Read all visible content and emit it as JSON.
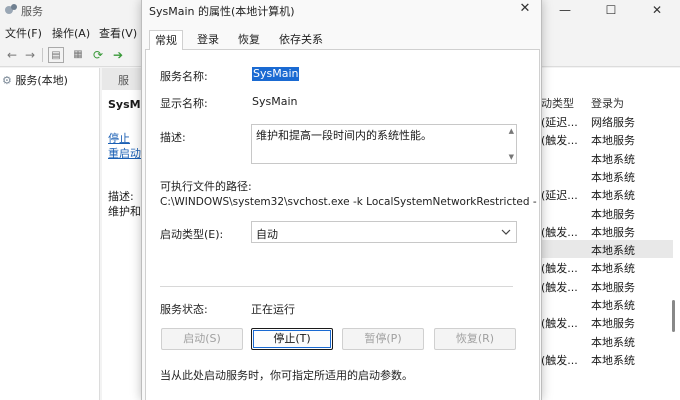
{
  "bg_window": {
    "title": "服务",
    "controls": [
      "—",
      "☐",
      "✕"
    ],
    "menu": [
      "文件(F)",
      "操作(A)",
      "查看(V)"
    ],
    "tree_item": "服务(本地)",
    "detail_header": "服",
    "detail": {
      "name": "SysM",
      "link_stop": "停止",
      "link_restart": "重启动",
      "desc_label": "描述:",
      "desc_text": "维护和"
    },
    "list": {
      "headers": [
        "动类型",
        "登录为"
      ],
      "rows": [
        {
          "startup": "(延迟...",
          "logon": "网络服务",
          "selected": false
        },
        {
          "startup": "(触发...",
          "logon": "本地服务",
          "selected": false
        },
        {
          "startup": "",
          "logon": "本地系统",
          "selected": false
        },
        {
          "startup": "",
          "logon": "本地系统",
          "selected": false
        },
        {
          "startup": "(延迟...",
          "logon": "本地系统",
          "selected": false
        },
        {
          "startup": "",
          "logon": "本地服务",
          "selected": false
        },
        {
          "startup": "(触发...",
          "logon": "本地服务",
          "selected": false
        },
        {
          "startup": "",
          "logon": "本地系统",
          "selected": true
        },
        {
          "startup": "(触发...",
          "logon": "本地系统",
          "selected": false
        },
        {
          "startup": "(触发...",
          "logon": "本地服务",
          "selected": false
        },
        {
          "startup": "",
          "logon": "本地系统",
          "selected": false
        },
        {
          "startup": "(触发...",
          "logon": "本地服务",
          "selected": false
        },
        {
          "startup": "",
          "logon": "本地系统",
          "selected": false
        },
        {
          "startup": "(触发...",
          "logon": "本地系统",
          "selected": false
        }
      ]
    }
  },
  "dialog": {
    "title": "SysMain 的属性(本地计算机)",
    "close": "✕",
    "tabs": [
      "常规",
      "登录",
      "恢复",
      "依存关系"
    ],
    "active_tab": "常规",
    "service_name_label": "服务名称:",
    "service_name": "SysMain",
    "display_name_label": "显示名称:",
    "display_name": "SysMain",
    "description_label": "描述:",
    "description": "维护和提高一段时间内的系统性能。",
    "path_label": "可执行文件的路径:",
    "path": "C:\\WINDOWS\\system32\\svchost.exe -k LocalSystemNetworkRestricted -",
    "startup_type_label": "启动类型(E):",
    "startup_type": "自动",
    "status_label": "服务状态:",
    "status": "正在运行",
    "buttons": {
      "start": "启动(S)",
      "stop": "停止(T)",
      "pause": "暂停(P)",
      "resume": "恢复(R)"
    },
    "hint": "当从此处启动服务时，你可指定所适用的启动参数。"
  }
}
